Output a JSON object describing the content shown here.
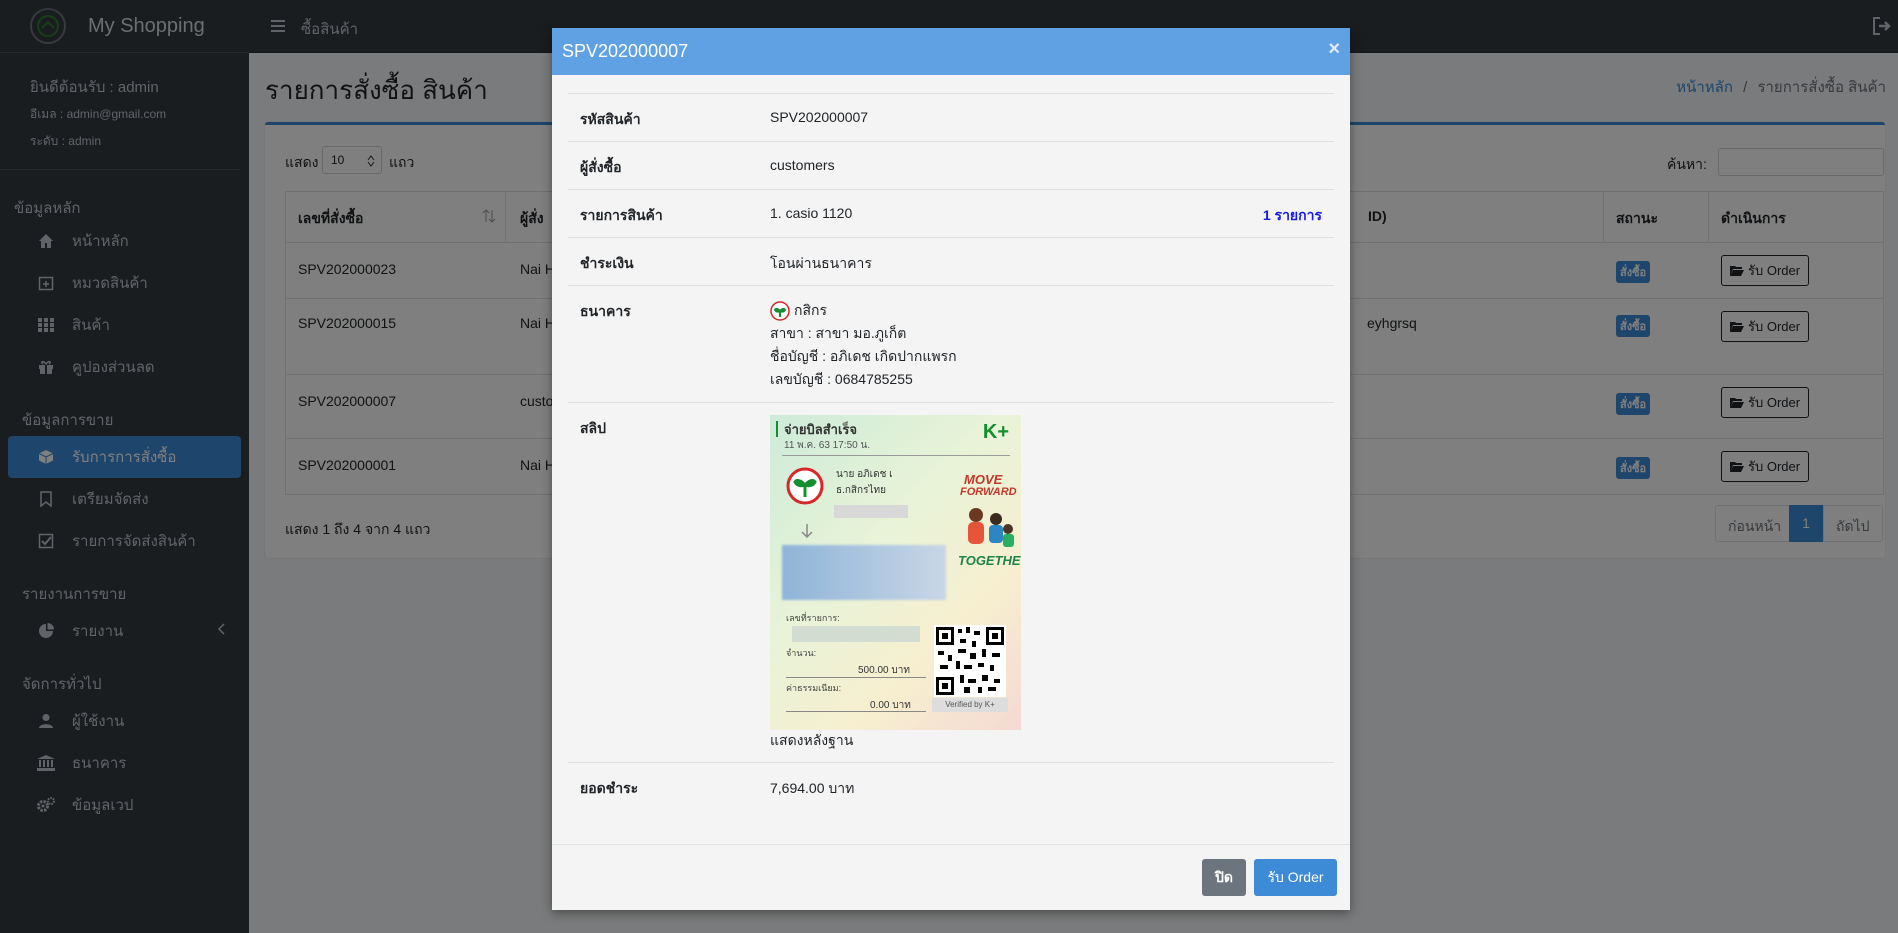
{
  "app": {
    "title": "My Shopping",
    "topbar_link": "ซื้อสินค้า"
  },
  "user": {
    "welcome": "ยินดีต้อนรับ : admin",
    "email": "อีเมล : admin@gmail.com",
    "level": "ระดับ : admin"
  },
  "sidebar": {
    "section_main": "ข้อมูลหลัก",
    "section_sales": "ข้อมูลการขาย",
    "section_report": "รายงานการขาย",
    "section_general": "จัดการทั่วไป",
    "items": [
      {
        "label": "หน้าหลัก",
        "icon": "home-icon"
      },
      {
        "label": "หมวดสินค้า",
        "icon": "calendar-plus-icon"
      },
      {
        "label": "สินค้า",
        "icon": "grid-icon"
      },
      {
        "label": "คูปองส่วนลด",
        "icon": "gift-icon"
      },
      {
        "label": "รับการการสั่งซื้อ",
        "icon": "cube-icon"
      },
      {
        "label": "เตรียมจัดส่ง",
        "icon": "bookmark-icon"
      },
      {
        "label": "รายการจัดส่งสินค้า",
        "icon": "check-square-icon"
      },
      {
        "label": "รายงาน",
        "icon": "pie-chart-icon"
      },
      {
        "label": "ผู้ใช้งาน",
        "icon": "user-icon"
      },
      {
        "label": "ธนาคาร",
        "icon": "bank-icon"
      },
      {
        "label": "ข้อมูลเวป",
        "icon": "cogs-icon"
      }
    ]
  },
  "page": {
    "title": "รายการสั่งซื้อ สินค้า",
    "breadcrumb_home": "หน้าหลัก",
    "breadcrumb_sep": "/",
    "breadcrumb_current": "รายการสั่งซื้อ สินค้า"
  },
  "table": {
    "show_label": "แสดง",
    "show_value": "10",
    "show_suffix": "แถว",
    "search_label": "ค้นหา:",
    "headers": {
      "order_no": "เลขที่สั่งซื้อ",
      "buyer": "ผู้สั่ง",
      "tracking": "ID)",
      "status": "สถานะ",
      "action": "ดำเนินการ"
    },
    "rows": [
      {
        "order_no": "SPV202000023",
        "buyer": "Nai H",
        "tracking": "",
        "status": "สั่งซื้อ",
        "action": "รับ Order"
      },
      {
        "order_no": "SPV202000015",
        "buyer": "Nai H",
        "tracking": "eyhgrsq",
        "status": "สั่งซื้อ",
        "action": "รับ Order"
      },
      {
        "order_no": "SPV202000007",
        "buyer": "custo",
        "tracking": "",
        "status": "สั่งซื้อ",
        "action": "รับ Order"
      },
      {
        "order_no": "SPV202000001",
        "buyer": "Nai H",
        "tracking": "",
        "status": "สั่งซื้อ",
        "action": "รับ Order"
      }
    ],
    "info": "แสดง 1 ถึง 4 จาก 4 แถว",
    "pagination": {
      "prev": "ก่อนหน้า",
      "current": "1",
      "next": "ถัดไป"
    }
  },
  "modal": {
    "title": "SPV202000007",
    "fields": {
      "code_label": "รหัสสินค้า",
      "code_value": "SPV202000007",
      "buyer_label": "ผู้สั่งซื้อ",
      "buyer_value": "customers",
      "items_label": "รายการสินค้า",
      "items_value": "1. casio 1120",
      "items_count": "1 รายการ",
      "payment_label": "ชำระเงิน",
      "payment_value": "โอนผ่านธนาคาร",
      "bank_label": "ธนาคาร",
      "bank_name": "กสิกร",
      "bank_branch": "สาขา : สาขา มอ.ภูเก็ต",
      "bank_account_name": "ชื่อบัญชี : อภิเดช เกิดปากแพรก",
      "bank_account_no": "เลขบัญชี : 0684785255",
      "slip_label": "สลิป",
      "slip_caption": "แสดงหลังฐาน",
      "total_label": "ยอดชำระ",
      "total_value": "7,694.00 บาท"
    },
    "slip": {
      "title": "จ่ายบิลสำเร็จ",
      "datetime": "11 พ.ค. 63  17:50 น.",
      "logo": "K+",
      "sender": "นาย อภิเดช เ",
      "sender_bank": "ธ.กสิกรไทย",
      "promo_1": "MOVE",
      "promo_2": "FORWARD",
      "promo_3": "TOGETHER",
      "ref_label": "เลขที่รายการ:",
      "amount_label": "จำนวน:",
      "amount_value": "500.00 บาท",
      "fee_label": "ค่าธรรมเนียม:",
      "fee_value": "0.00 บาท",
      "verified": "Verified by K+"
    },
    "buttons": {
      "close": "ปิด",
      "accept": "รับ Order"
    },
    "close_symbol": "×"
  },
  "colors": {
    "sidebar": "#343a40",
    "accent": "#3d8ad6",
    "modal_header": "#5fa1e2",
    "kbank_green": "#138f2d"
  }
}
